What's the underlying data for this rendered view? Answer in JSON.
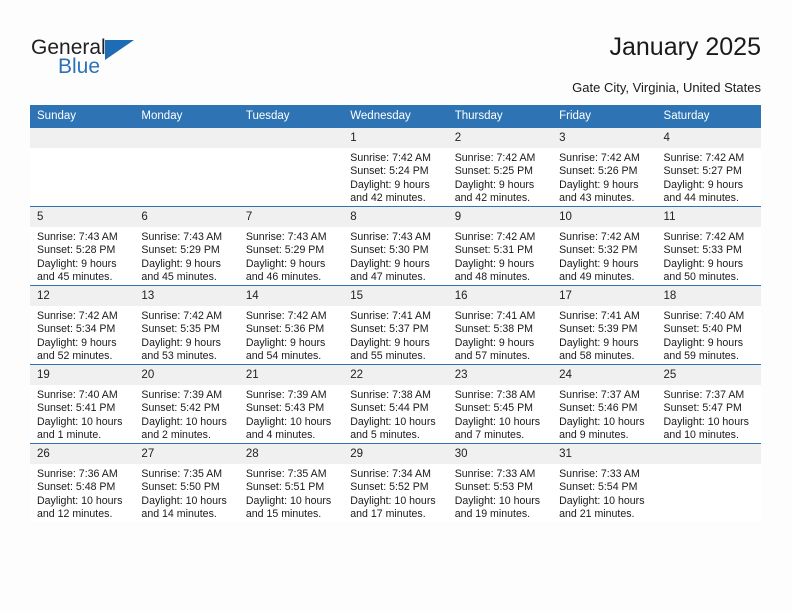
{
  "brand": {
    "name_part1": "General",
    "name_part2": "Blue",
    "triangle_icon": "triangle-logo-icon",
    "accent_color": "#2e74b5"
  },
  "header": {
    "title": "January 2025",
    "location": "Gate City, Virginia, United States"
  },
  "calendar": {
    "weekday_headers": [
      "Sunday",
      "Monday",
      "Tuesday",
      "Wednesday",
      "Thursday",
      "Friday",
      "Saturday"
    ],
    "header_bg": "#2e74b5",
    "daynum_bg": "#f0f0f0",
    "weeks": [
      [
        {
          "day": "",
          "sunrise": "",
          "sunset": "",
          "daylight_line1": "",
          "daylight_line2": ""
        },
        {
          "day": "",
          "sunrise": "",
          "sunset": "",
          "daylight_line1": "",
          "daylight_line2": ""
        },
        {
          "day": "",
          "sunrise": "",
          "sunset": "",
          "daylight_line1": "",
          "daylight_line2": ""
        },
        {
          "day": "1",
          "sunrise": "Sunrise: 7:42 AM",
          "sunset": "Sunset: 5:24 PM",
          "daylight_line1": "Daylight: 9 hours",
          "daylight_line2": "and 42 minutes."
        },
        {
          "day": "2",
          "sunrise": "Sunrise: 7:42 AM",
          "sunset": "Sunset: 5:25 PM",
          "daylight_line1": "Daylight: 9 hours",
          "daylight_line2": "and 42 minutes."
        },
        {
          "day": "3",
          "sunrise": "Sunrise: 7:42 AM",
          "sunset": "Sunset: 5:26 PM",
          "daylight_line1": "Daylight: 9 hours",
          "daylight_line2": "and 43 minutes."
        },
        {
          "day": "4",
          "sunrise": "Sunrise: 7:42 AM",
          "sunset": "Sunset: 5:27 PM",
          "daylight_line1": "Daylight: 9 hours",
          "daylight_line2": "and 44 minutes."
        }
      ],
      [
        {
          "day": "5",
          "sunrise": "Sunrise: 7:43 AM",
          "sunset": "Sunset: 5:28 PM",
          "daylight_line1": "Daylight: 9 hours",
          "daylight_line2": "and 45 minutes."
        },
        {
          "day": "6",
          "sunrise": "Sunrise: 7:43 AM",
          "sunset": "Sunset: 5:29 PM",
          "daylight_line1": "Daylight: 9 hours",
          "daylight_line2": "and 45 minutes."
        },
        {
          "day": "7",
          "sunrise": "Sunrise: 7:43 AM",
          "sunset": "Sunset: 5:29 PM",
          "daylight_line1": "Daylight: 9 hours",
          "daylight_line2": "and 46 minutes."
        },
        {
          "day": "8",
          "sunrise": "Sunrise: 7:43 AM",
          "sunset": "Sunset: 5:30 PM",
          "daylight_line1": "Daylight: 9 hours",
          "daylight_line2": "and 47 minutes."
        },
        {
          "day": "9",
          "sunrise": "Sunrise: 7:42 AM",
          "sunset": "Sunset: 5:31 PM",
          "daylight_line1": "Daylight: 9 hours",
          "daylight_line2": "and 48 minutes."
        },
        {
          "day": "10",
          "sunrise": "Sunrise: 7:42 AM",
          "sunset": "Sunset: 5:32 PM",
          "daylight_line1": "Daylight: 9 hours",
          "daylight_line2": "and 49 minutes."
        },
        {
          "day": "11",
          "sunrise": "Sunrise: 7:42 AM",
          "sunset": "Sunset: 5:33 PM",
          "daylight_line1": "Daylight: 9 hours",
          "daylight_line2": "and 50 minutes."
        }
      ],
      [
        {
          "day": "12",
          "sunrise": "Sunrise: 7:42 AM",
          "sunset": "Sunset: 5:34 PM",
          "daylight_line1": "Daylight: 9 hours",
          "daylight_line2": "and 52 minutes."
        },
        {
          "day": "13",
          "sunrise": "Sunrise: 7:42 AM",
          "sunset": "Sunset: 5:35 PM",
          "daylight_line1": "Daylight: 9 hours",
          "daylight_line2": "and 53 minutes."
        },
        {
          "day": "14",
          "sunrise": "Sunrise: 7:42 AM",
          "sunset": "Sunset: 5:36 PM",
          "daylight_line1": "Daylight: 9 hours",
          "daylight_line2": "and 54 minutes."
        },
        {
          "day": "15",
          "sunrise": "Sunrise: 7:41 AM",
          "sunset": "Sunset: 5:37 PM",
          "daylight_line1": "Daylight: 9 hours",
          "daylight_line2": "and 55 minutes."
        },
        {
          "day": "16",
          "sunrise": "Sunrise: 7:41 AM",
          "sunset": "Sunset: 5:38 PM",
          "daylight_line1": "Daylight: 9 hours",
          "daylight_line2": "and 57 minutes."
        },
        {
          "day": "17",
          "sunrise": "Sunrise: 7:41 AM",
          "sunset": "Sunset: 5:39 PM",
          "daylight_line1": "Daylight: 9 hours",
          "daylight_line2": "and 58 minutes."
        },
        {
          "day": "18",
          "sunrise": "Sunrise: 7:40 AM",
          "sunset": "Sunset: 5:40 PM",
          "daylight_line1": "Daylight: 9 hours",
          "daylight_line2": "and 59 minutes."
        }
      ],
      [
        {
          "day": "19",
          "sunrise": "Sunrise: 7:40 AM",
          "sunset": "Sunset: 5:41 PM",
          "daylight_line1": "Daylight: 10 hours",
          "daylight_line2": "and 1 minute."
        },
        {
          "day": "20",
          "sunrise": "Sunrise: 7:39 AM",
          "sunset": "Sunset: 5:42 PM",
          "daylight_line1": "Daylight: 10 hours",
          "daylight_line2": "and 2 minutes."
        },
        {
          "day": "21",
          "sunrise": "Sunrise: 7:39 AM",
          "sunset": "Sunset: 5:43 PM",
          "daylight_line1": "Daylight: 10 hours",
          "daylight_line2": "and 4 minutes."
        },
        {
          "day": "22",
          "sunrise": "Sunrise: 7:38 AM",
          "sunset": "Sunset: 5:44 PM",
          "daylight_line1": "Daylight: 10 hours",
          "daylight_line2": "and 5 minutes."
        },
        {
          "day": "23",
          "sunrise": "Sunrise: 7:38 AM",
          "sunset": "Sunset: 5:45 PM",
          "daylight_line1": "Daylight: 10 hours",
          "daylight_line2": "and 7 minutes."
        },
        {
          "day": "24",
          "sunrise": "Sunrise: 7:37 AM",
          "sunset": "Sunset: 5:46 PM",
          "daylight_line1": "Daylight: 10 hours",
          "daylight_line2": "and 9 minutes."
        },
        {
          "day": "25",
          "sunrise": "Sunrise: 7:37 AM",
          "sunset": "Sunset: 5:47 PM",
          "daylight_line1": "Daylight: 10 hours",
          "daylight_line2": "and 10 minutes."
        }
      ],
      [
        {
          "day": "26",
          "sunrise": "Sunrise: 7:36 AM",
          "sunset": "Sunset: 5:48 PM",
          "daylight_line1": "Daylight: 10 hours",
          "daylight_line2": "and 12 minutes."
        },
        {
          "day": "27",
          "sunrise": "Sunrise: 7:35 AM",
          "sunset": "Sunset: 5:50 PM",
          "daylight_line1": "Daylight: 10 hours",
          "daylight_line2": "and 14 minutes."
        },
        {
          "day": "28",
          "sunrise": "Sunrise: 7:35 AM",
          "sunset": "Sunset: 5:51 PM",
          "daylight_line1": "Daylight: 10 hours",
          "daylight_line2": "and 15 minutes."
        },
        {
          "day": "29",
          "sunrise": "Sunrise: 7:34 AM",
          "sunset": "Sunset: 5:52 PM",
          "daylight_line1": "Daylight: 10 hours",
          "daylight_line2": "and 17 minutes."
        },
        {
          "day": "30",
          "sunrise": "Sunrise: 7:33 AM",
          "sunset": "Sunset: 5:53 PM",
          "daylight_line1": "Daylight: 10 hours",
          "daylight_line2": "and 19 minutes."
        },
        {
          "day": "31",
          "sunrise": "Sunrise: 7:33 AM",
          "sunset": "Sunset: 5:54 PM",
          "daylight_line1": "Daylight: 10 hours",
          "daylight_line2": "and 21 minutes."
        },
        {
          "day": "",
          "sunrise": "",
          "sunset": "",
          "daylight_line1": "",
          "daylight_line2": ""
        }
      ]
    ]
  }
}
